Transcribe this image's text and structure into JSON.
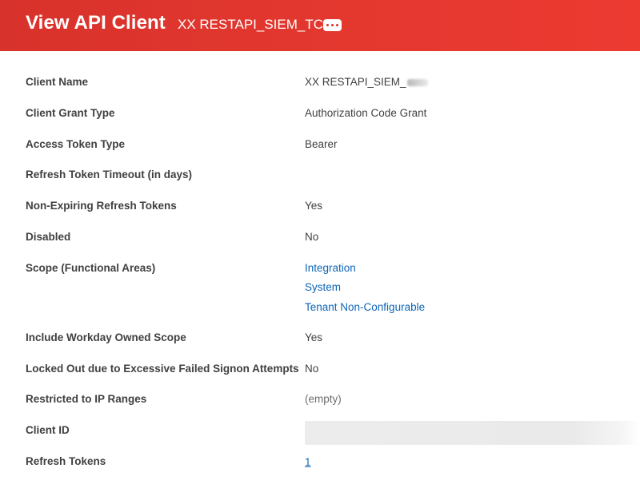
{
  "header": {
    "title": "View API Client",
    "subject": "XX RESTAPI_SIEM_TCS",
    "related_actions_icon": "more-horizontal-icon",
    "brand_color": "#e23a31"
  },
  "fields": {
    "client_name": {
      "label": "Client Name",
      "value": "XX RESTAPI_SIEM_"
    },
    "client_grant_type": {
      "label": "Client Grant Type",
      "value": "Authorization Code Grant"
    },
    "access_token_type": {
      "label": "Access Token Type",
      "value": "Bearer"
    },
    "refresh_token_timeout": {
      "label": "Refresh Token Timeout (in days)",
      "value": ""
    },
    "non_expiring_refresh_tokens": {
      "label": "Non-Expiring Refresh Tokens",
      "value": "Yes"
    },
    "disabled": {
      "label": "Disabled",
      "value": "No"
    },
    "scope": {
      "label": "Scope (Functional Areas)",
      "values": [
        "Integration",
        "System",
        "Tenant Non-Configurable"
      ]
    },
    "include_workday_owned_scope": {
      "label": "Include Workday Owned Scope",
      "value": "Yes"
    },
    "locked_out": {
      "label": "Locked Out due to Excessive Failed Signon Attempts",
      "value": "No"
    },
    "restricted_ip_ranges": {
      "label": "Restricted to IP Ranges",
      "value": "(empty)"
    },
    "client_id": {
      "label": "Client ID",
      "value": ""
    },
    "refresh_tokens": {
      "label": "Refresh Tokens",
      "value": "1"
    }
  },
  "colors": {
    "link": "#0e65b6",
    "label_text": "#404040",
    "empty_text": "#6d6d6d"
  }
}
